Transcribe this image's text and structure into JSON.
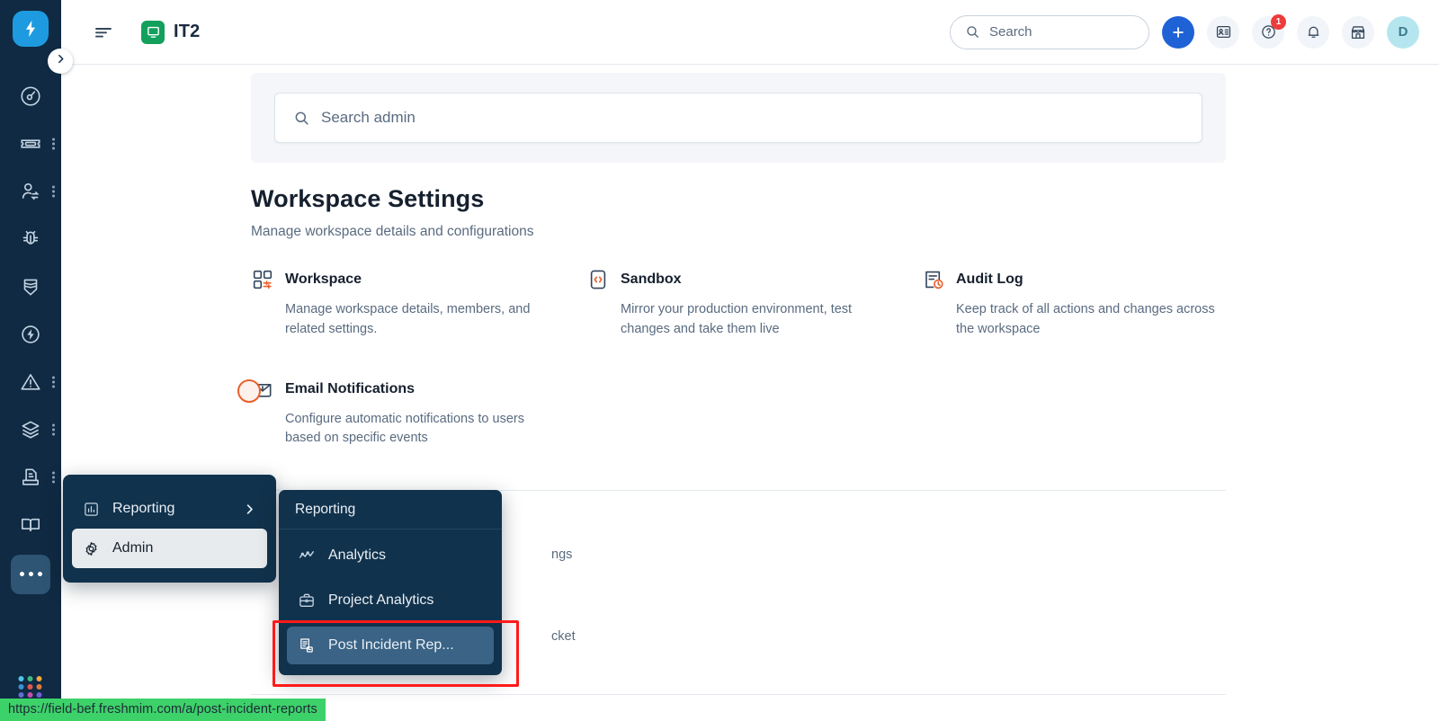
{
  "app": {
    "rail_logo_icon": "freshservice-bolt-logo",
    "collapse_chevron_icon": "chevron-right-icon",
    "rail_items": [
      {
        "icon": "dashboard-gauge-icon",
        "name": "dashboard",
        "has_dots": false
      },
      {
        "icon": "ticket-icon",
        "name": "tickets",
        "has_dots": true
      },
      {
        "icon": "user-switch-icon",
        "name": "requesters",
        "has_dots": true
      },
      {
        "icon": "bug-icon",
        "name": "problems",
        "has_dots": false
      },
      {
        "icon": "shield-icon",
        "name": "changes",
        "has_dots": false
      },
      {
        "icon": "bolt-circle-icon",
        "name": "releases",
        "has_dots": false
      },
      {
        "icon": "alert-triangle-icon",
        "name": "alerts",
        "has_dots": true
      },
      {
        "icon": "layers-icon",
        "name": "assets",
        "has_dots": true
      },
      {
        "icon": "document-tray-icon",
        "name": "contracts",
        "has_dots": true
      },
      {
        "icon": "book-open-icon",
        "name": "solutions",
        "has_dots": false
      }
    ],
    "rail_more_icon": "ellipsis-icon",
    "rail_grid_icon": "app-switcher-grid-icon"
  },
  "topbar": {
    "hamburger_icon": "hamburger-menu-icon",
    "workspace_badge_icon": "monitor-screen-icon",
    "workspace_name": "IT2",
    "search": {
      "icon": "search-icon",
      "placeholder": "Search"
    },
    "actions": [
      {
        "name": "add-new-button",
        "icon": "plus-icon"
      },
      {
        "name": "contacts-button",
        "icon": "contact-card-icon"
      },
      {
        "name": "help-button",
        "icon": "question-circle-icon",
        "badge": "1"
      },
      {
        "name": "notifications-button",
        "icon": "bell-icon"
      },
      {
        "name": "marketplace-button",
        "icon": "storefront-icon"
      }
    ],
    "avatar_initial": "D"
  },
  "admin": {
    "search": {
      "icon": "search-icon",
      "placeholder": "Search admin"
    },
    "title": "Workspace Settings",
    "subtitle": "Manage workspace details and configurations",
    "cards": [
      {
        "icon": "workspace-grid-icon",
        "title": "Workspace",
        "description": "Manage workspace details, members, and related settings."
      },
      {
        "icon": "sandbox-code-icon",
        "title": "Sandbox",
        "description": "Mirror your production environment, test changes and take them live"
      },
      {
        "icon": "audit-log-clock-icon",
        "title": "Audit Log",
        "description": "Keep track of all actions and changes across the workspace"
      },
      {
        "icon": "email-envelope-icon",
        "title": "Email Notifications",
        "description": "Configure automatic notifications to users based on specific events"
      }
    ],
    "obscured_text_1": "ngs",
    "obscured_text_2": "cket"
  },
  "menus": {
    "primary": {
      "items": [
        {
          "label": "Reporting",
          "icon": "bar-chart-icon",
          "has_submenu": true,
          "selected": false
        },
        {
          "label": "Admin",
          "icon": "gear-icon",
          "has_submenu": false,
          "selected": true
        }
      ],
      "submenu_caret_icon": "chevron-right-icon"
    },
    "submenu": {
      "header": "Reporting",
      "items": [
        {
          "label": "Analytics",
          "icon": "analytics-wave-icon",
          "active": false
        },
        {
          "label": "Project Analytics",
          "icon": "briefcase-icon",
          "active": false
        },
        {
          "label": "Post Incident Rep...",
          "icon": "incident-report-icon",
          "active": true
        }
      ]
    }
  },
  "status_bar": {
    "url": "https://field-bef.freshmim.com/a/post-incident-reports"
  },
  "colors": {
    "rail_bg": "#102A43",
    "menu_bg": "#11324C",
    "menu_active": "#3A6385",
    "accent_blue": "#1F62D6",
    "accent_orange": "#E8602C",
    "brand_green": "#12A05C",
    "highlight_red": "#FF1A1A",
    "status_green": "#3DD16A"
  }
}
